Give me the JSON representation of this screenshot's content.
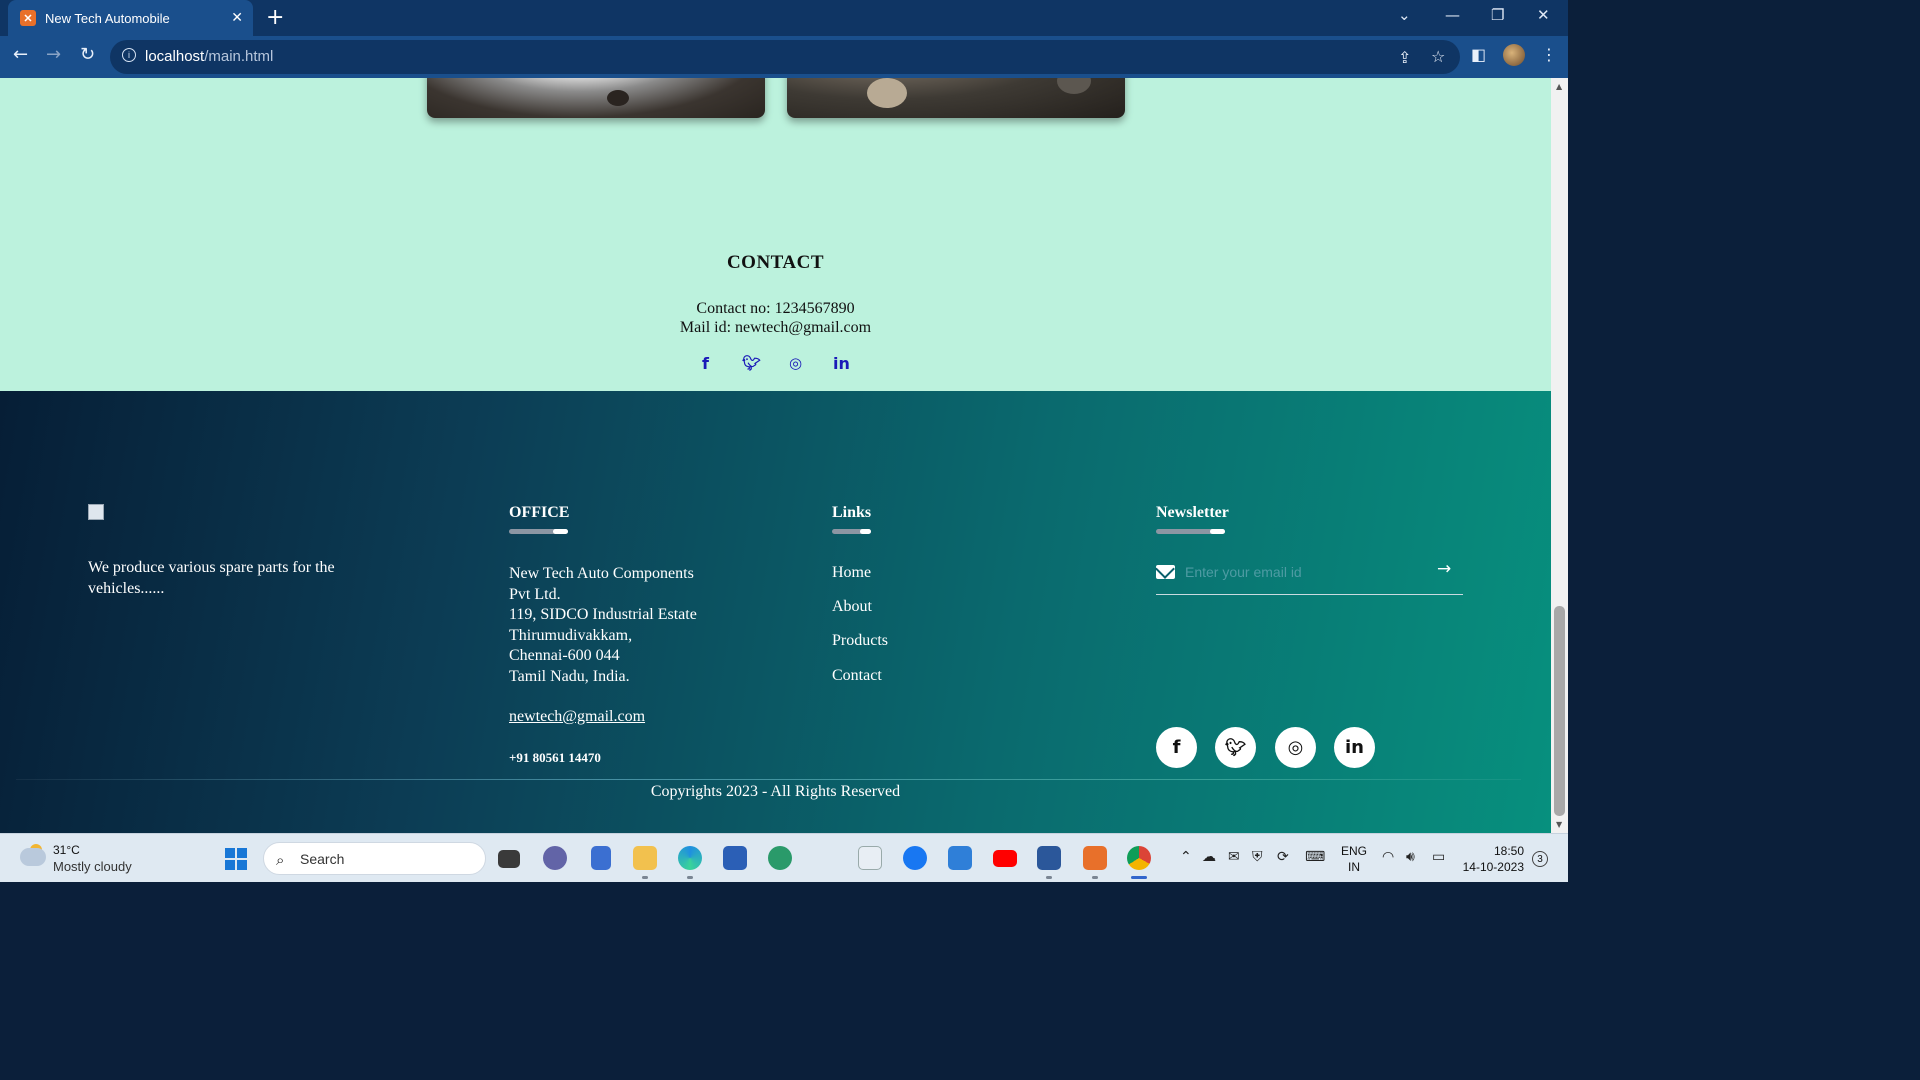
{
  "browser": {
    "tab_title": "New Tech Automobile",
    "tab_close": "✕",
    "new_tab": "+",
    "url_host": "localhost",
    "url_path": "/main.html"
  },
  "contact": {
    "title": "CONTACT",
    "phone_line": "Contact no: 1234567890",
    "mail_line": "Mail id: newtech@gmail.com",
    "social_icons": [
      "facebook-icon",
      "twitter-icon",
      "instagram-icon",
      "linkedin-icon"
    ]
  },
  "footer": {
    "about_text": "We produce various spare parts for the vehicles......",
    "office": {
      "heading": "OFFICE",
      "address_lines": [
        "New Tech Auto Components",
        "Pvt Ltd.",
        "119, SIDCO Industrial Estate",
        "Thirumudivakkam,",
        "Chennai-600 044",
        "Tamil Nadu, India."
      ],
      "email": "newtech@gmail.com",
      "phone": "+91 80561 14470"
    },
    "links": {
      "heading": "Links",
      "items": [
        "Home",
        "About",
        "Products",
        "Contact"
      ]
    },
    "newsletter": {
      "heading": "Newsletter",
      "placeholder": "Enter your email id",
      "submit_icon": "arrow-right-icon",
      "social_icons": [
        "facebook-icon",
        "twitter-icon",
        "instagram-icon",
        "linkedin-icon"
      ]
    },
    "copyright": "Copyrights 2023 - All Rights Reserved"
  },
  "taskbar": {
    "temperature": "31°C",
    "weather": "Mostly cloudy",
    "search_label": "Search",
    "lang_primary": "ENG",
    "lang_secondary": "IN",
    "time": "18:50",
    "date": "14-10-2023",
    "notification_count": "3"
  },
  "colors": {
    "page_bg": "#bcf2dd",
    "footer_gradient_start": "#061e36",
    "footer_gradient_end": "#07907e",
    "social_link_color": "#1a1ab8",
    "browser_chrome": "#1a4f8c"
  }
}
